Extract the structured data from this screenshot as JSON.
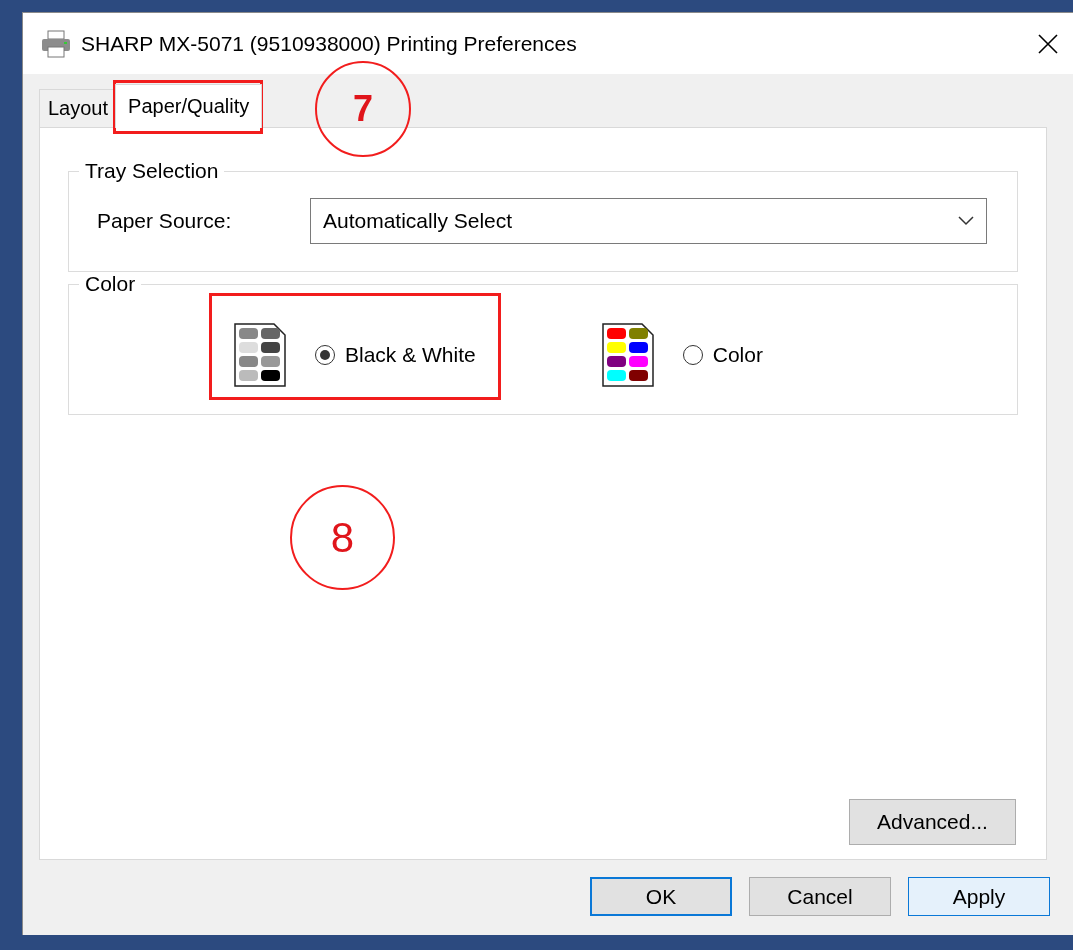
{
  "window": {
    "title": "SHARP MX-5071 (9510938000) Printing Preferences"
  },
  "tabs": [
    {
      "label": "Layout",
      "selected": false,
      "highlighted": false
    },
    {
      "label": "Paper/Quality",
      "selected": true,
      "highlighted": true
    }
  ],
  "tray_selection": {
    "legend": "Tray Selection",
    "paper_source": {
      "label": "Paper Source:",
      "value": "Automatically Select"
    }
  },
  "color": {
    "legend": "Color",
    "options": [
      {
        "label": "Black & White",
        "kind": "mono",
        "selected": true,
        "highlighted": true
      },
      {
        "label": "Color",
        "kind": "color",
        "selected": false,
        "highlighted": false
      }
    ]
  },
  "advanced_button": "Advanced...",
  "buttons": [
    {
      "label": "OK",
      "kind": "default"
    },
    {
      "label": "Cancel",
      "kind": "normal"
    },
    {
      "label": "Apply",
      "kind": "hover"
    }
  ],
  "callouts": [
    {
      "label": "7",
      "bold": true
    },
    {
      "label": "8",
      "bold": false
    }
  ]
}
